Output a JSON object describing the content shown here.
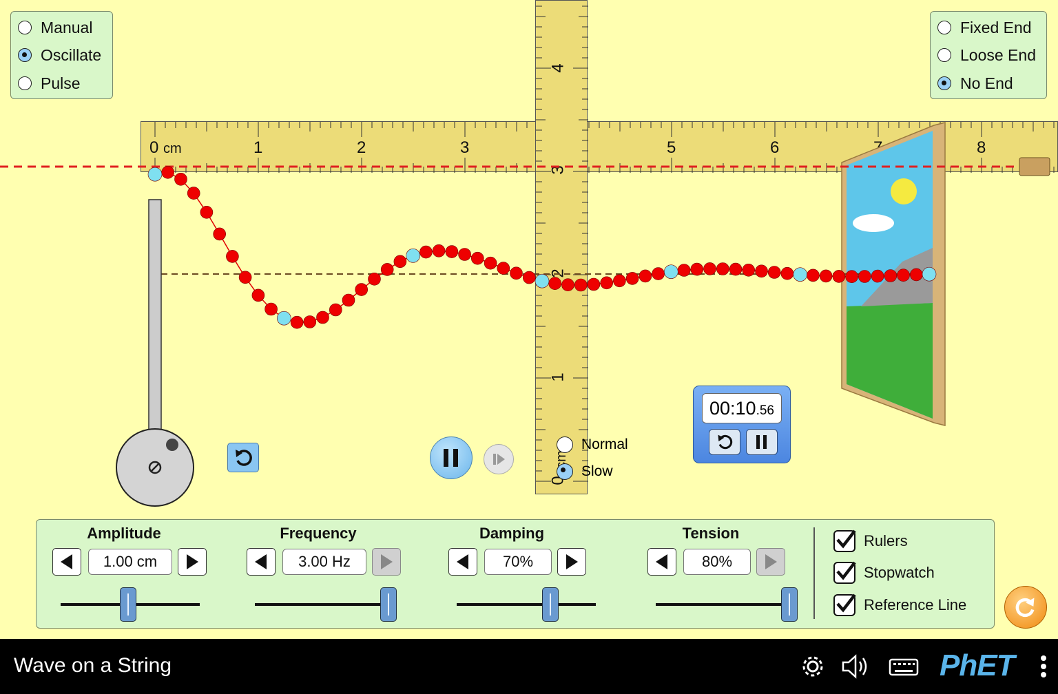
{
  "mode_panel": {
    "items": [
      {
        "label": "Manual",
        "selected": false
      },
      {
        "label": "Oscillate",
        "selected": true
      },
      {
        "label": "Pulse",
        "selected": false
      }
    ]
  },
  "end_panel": {
    "items": [
      {
        "label": "Fixed End",
        "selected": false
      },
      {
        "label": "Loose End",
        "selected": false
      },
      {
        "label": "No End",
        "selected": true
      }
    ]
  },
  "horizontal_ruler": {
    "unit": "cm",
    "ticks": [
      "0",
      "1",
      "2",
      "3",
      "5",
      "6",
      "7",
      "8"
    ]
  },
  "vertical_ruler": {
    "unit": "cm",
    "ticks": [
      "4",
      "3",
      "2",
      "1",
      "0"
    ]
  },
  "speed": {
    "items": [
      {
        "label": "Normal",
        "selected": false
      },
      {
        "label": "Slow",
        "selected": true
      }
    ]
  },
  "stopwatch": {
    "time_main": "00:10",
    "time_fraction": ".56"
  },
  "controls": {
    "amplitude": {
      "title": "Amplitude",
      "value": "1.00 cm",
      "fraction": 0.5,
      "right_enabled": true,
      "left_enabled": true
    },
    "frequency": {
      "title": "Frequency",
      "value": "3.00 Hz",
      "fraction": 1.0,
      "right_enabled": false,
      "left_enabled": true
    },
    "damping": {
      "title": "Damping",
      "value": "70%",
      "fraction": 0.7,
      "right_enabled": true,
      "left_enabled": true
    },
    "tension": {
      "title": "Tension",
      "value": "80%",
      "fraction": 1.0,
      "right_enabled": false,
      "left_enabled": true
    }
  },
  "checkboxes": [
    {
      "label": "Rulers",
      "checked": true
    },
    {
      "label": "Stopwatch",
      "checked": true
    },
    {
      "label": "Reference Line",
      "checked": true
    }
  ],
  "footer": {
    "title": "Wave on a String",
    "brand": "PhET"
  },
  "colors": {
    "background": "#ffffb0",
    "panel": "#d9f7c9",
    "bead": "#ee0000",
    "marker_bead": "#7fe0f0",
    "reference_line": "#e02020"
  }
}
